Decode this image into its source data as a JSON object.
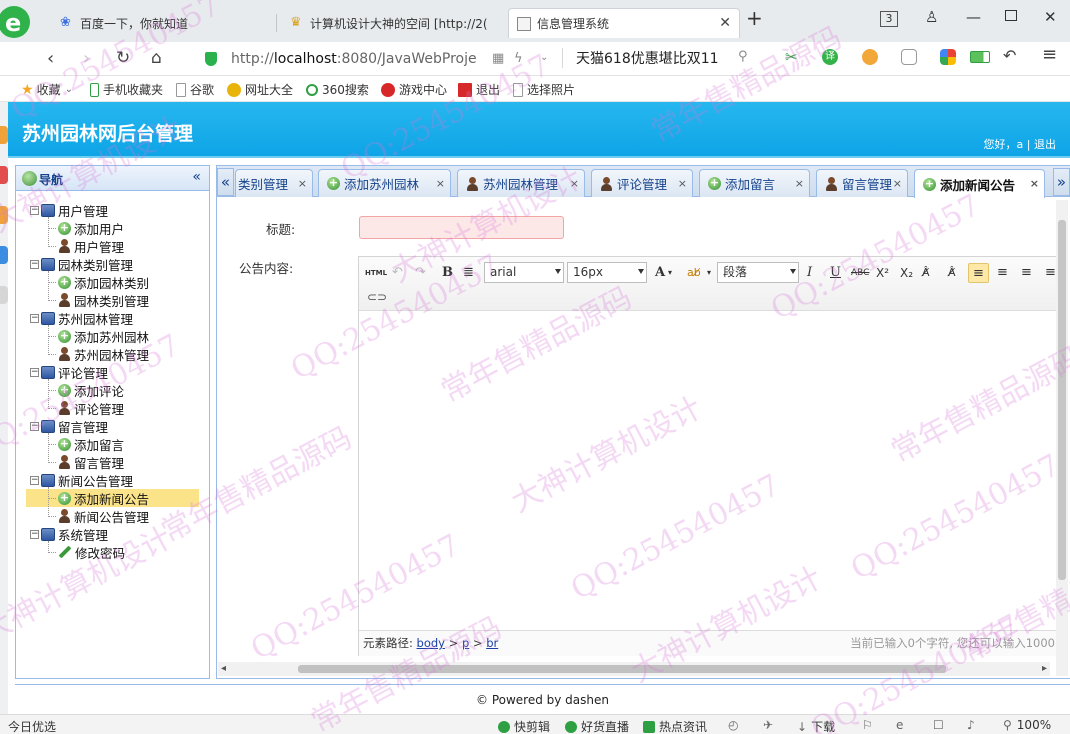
{
  "browser": {
    "tabs": [
      {
        "label": "百度一下，你就知道"
      },
      {
        "label": "计算机设计大神的空间 [http://2("
      },
      {
        "label": "信息管理系统"
      }
    ],
    "new_tab": "+",
    "window_tab_count": "3",
    "url_scheme": "http://",
    "url_host": "localhost",
    "url_rest": ":8080/JavaWebProje",
    "promo_text": "天猫618优惠堪比双11",
    "bookmarks": [
      "收藏",
      "手机收藏夹",
      "谷歌",
      "网址大全",
      "360搜索",
      "游戏中心",
      "退出",
      "选择照片"
    ]
  },
  "app": {
    "title": "苏州园林网后台管理",
    "greeting": "您好，a | 退出",
    "footer": "© Powered by dashen"
  },
  "nav": {
    "title": "导航",
    "collapse": "«",
    "groups": [
      {
        "label": "用户管理",
        "items": [
          "添加用户",
          "用户管理"
        ]
      },
      {
        "label": "园林类别管理",
        "items": [
          "添加园林类别",
          "园林类别管理"
        ]
      },
      {
        "label": "苏州园林管理",
        "items": [
          "添加苏州园林",
          "苏州园林管理"
        ]
      },
      {
        "label": "评论管理",
        "items": [
          "添加评论",
          "评论管理"
        ]
      },
      {
        "label": "留言管理",
        "items": [
          "添加留言",
          "留言管理"
        ]
      },
      {
        "label": "新闻公告管理",
        "items": [
          "添加新闻公告",
          "新闻公告管理"
        ]
      },
      {
        "label": "系统管理",
        "items": [
          "修改密码"
        ]
      }
    ],
    "selected_item": "添加新闻公告"
  },
  "tabs": {
    "scroll_left": "«",
    "scroll_right": "»",
    "items": [
      "类别管理",
      "添加苏州园林",
      "苏州园林管理",
      "评论管理",
      "添加留言",
      "留言管理",
      "添加新闻公告"
    ],
    "active": "添加新闻公告",
    "close": "×"
  },
  "form": {
    "title_label": "标题:",
    "title_value": "",
    "content_label": "公告内容:"
  },
  "editor": {
    "toolbar": {
      "html": "HTML",
      "bold": "B",
      "font_family": "arial",
      "font_size": "16px",
      "font_color": "A",
      "paragraph": "段落",
      "italic": "I",
      "underline": "U",
      "strike": "ABC",
      "sup": "X²",
      "sub": "X₂"
    },
    "path_label": "元素路径:",
    "path": [
      "body",
      "p",
      "br"
    ],
    "path_sep": ">",
    "char_count": "当前已输入0个字符, 您还可以输入1000"
  },
  "statusbar": {
    "left": "今日优选",
    "items": [
      "快剪辑",
      "好货直播",
      "热点资讯",
      "下载"
    ],
    "zoom": "100%"
  },
  "watermarks": [
    "QQ:254540457",
    "常年售精品源码",
    "大神计算机设计"
  ],
  "colors": {
    "header_bg": "#19adeb",
    "panel_border": "#99bbe8",
    "nav_title": "#15428b",
    "selected_row": "#fbe38a",
    "title_input_bg": "#fde8e8"
  }
}
